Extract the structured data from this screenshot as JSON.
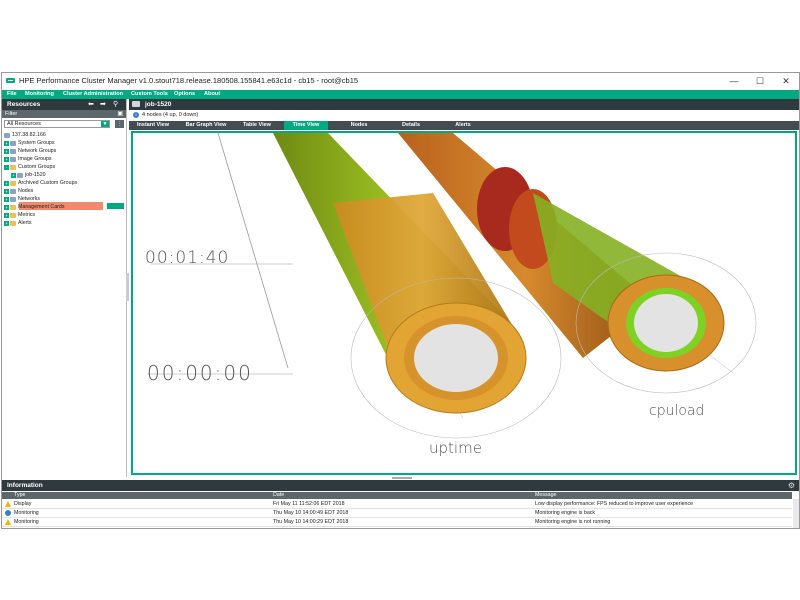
{
  "window": {
    "title": "HPE Performance Cluster Manager v1.0.stout718.release.180508.155841.e63c1d - cb15 - root@cb15"
  },
  "controls": {
    "minimize": "—",
    "maximize": "☐",
    "close": "✕"
  },
  "menu": [
    "File",
    "Monitoring",
    "Cluster Administration",
    "Custom Tools",
    "Options",
    "About"
  ],
  "resources": {
    "title": "Resources",
    "filter_label": "Filter",
    "filter_value": "All Resources",
    "tree": [
      {
        "label": "137.38.82.166",
        "expander": "",
        "icon": "server-icon"
      },
      {
        "label": "System Groups",
        "expander": "+",
        "icon": "group-icon"
      },
      {
        "label": "Network Groups",
        "expander": "+",
        "icon": "group-icon"
      },
      {
        "label": "Image Groups",
        "expander": "+",
        "icon": "group-icon"
      },
      {
        "label": "Custom Groups",
        "expander": "-",
        "icon": "folder-icon"
      },
      {
        "label": "job-1520",
        "expander": "+",
        "icon": "group-icon"
      },
      {
        "label": "Archived Custom Groups",
        "expander": "+",
        "icon": "folder-icon"
      },
      {
        "label": "Nodes",
        "expander": "+",
        "icon": "group-icon"
      },
      {
        "label": "Networks",
        "expander": "+",
        "icon": "network-icon"
      },
      {
        "label": "Management Cards",
        "expander": "+",
        "icon": "folder-icon"
      },
      {
        "label": "Metrics",
        "expander": "+",
        "icon": "folder-icon"
      },
      {
        "label": "Alerts",
        "expander": "+",
        "icon": "folder-icon"
      }
    ]
  },
  "job": {
    "title": "job-1520",
    "status": "4 nodes (4 up, 0 down)",
    "tabs": [
      "Instant View",
      "Bar Graph View",
      "Table View",
      "Time View",
      "Nodes",
      "Details",
      "Alerts"
    ],
    "active_tab": "Time View"
  },
  "visualization": {
    "time_labels": [
      "00:01:40",
      "00:00:00"
    ],
    "metric_labels": [
      "uptime",
      "cpuload"
    ]
  },
  "information": {
    "title": "Information",
    "columns": [
      "Type",
      "Date",
      "Message"
    ],
    "rows": [
      {
        "severity": "warning",
        "type": "Display",
        "date": "Fri May 11 11:52:06 EDT 2018",
        "message": "Low display performance: FPS reduced to improve user experience"
      },
      {
        "severity": "info",
        "type": "Monitoring",
        "date": "Thu May 10 14:00:49 EDT 2018",
        "message": "Monitoring engine is back"
      },
      {
        "severity": "warning",
        "type": "Monitoring",
        "date": "Thu May 10 14:00:29 EDT 2018",
        "message": "Monitoring engine is not running"
      }
    ]
  },
  "colors": {
    "accent": "#01a982",
    "header": "#2f3a3f",
    "selection": "#f08a6e"
  }
}
